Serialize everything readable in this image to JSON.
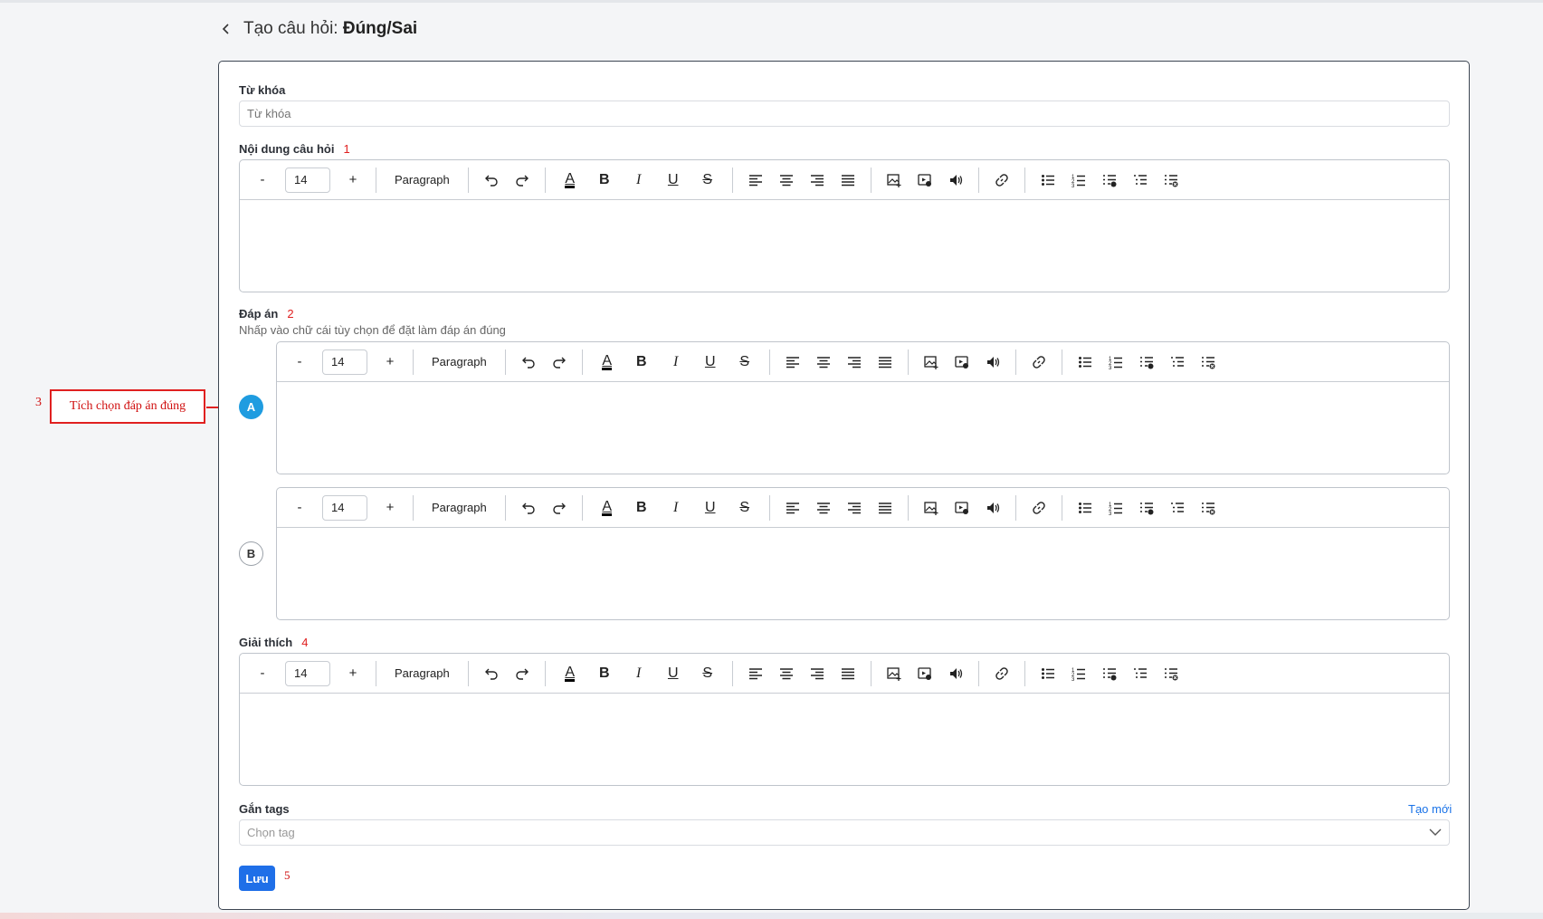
{
  "header": {
    "back_label": "<",
    "title_prefix": "Tạo câu hỏi: ",
    "title_type": "Đúng/Sai"
  },
  "keyword": {
    "label": "Từ khóa",
    "placeholder": "Từ khóa"
  },
  "question": {
    "label": "Nội dung câu hỏi",
    "annot_num": "1"
  },
  "answers": {
    "label": "Đáp án",
    "annot_num": "2",
    "hint": "Nhấp vào chữ cái tùy chọn để đặt làm đáp án đúng",
    "options": [
      {
        "letter": "A",
        "selected": true
      },
      {
        "letter": "B",
        "selected": false
      }
    ]
  },
  "explanation": {
    "label": "Giải thích",
    "annot_num": "4"
  },
  "tags": {
    "label": "Gắn tags",
    "create_link": "Tạo mới",
    "placeholder": "Chọn tag"
  },
  "save": {
    "label": "Lưu",
    "annot_num": "5"
  },
  "annotation": {
    "num": "3",
    "text": "Tích chọn đáp án đúng"
  },
  "toolbar": {
    "minus": "-",
    "font_size": "14",
    "plus": "+",
    "paragraph": "Paragraph",
    "bold": "B",
    "italic": "I",
    "underline": "U",
    "strike": "S",
    "color_a": "A"
  },
  "colors": {
    "accent": "#1f9ce0",
    "save": "#1f6fe8",
    "annotation": "#e02020"
  }
}
